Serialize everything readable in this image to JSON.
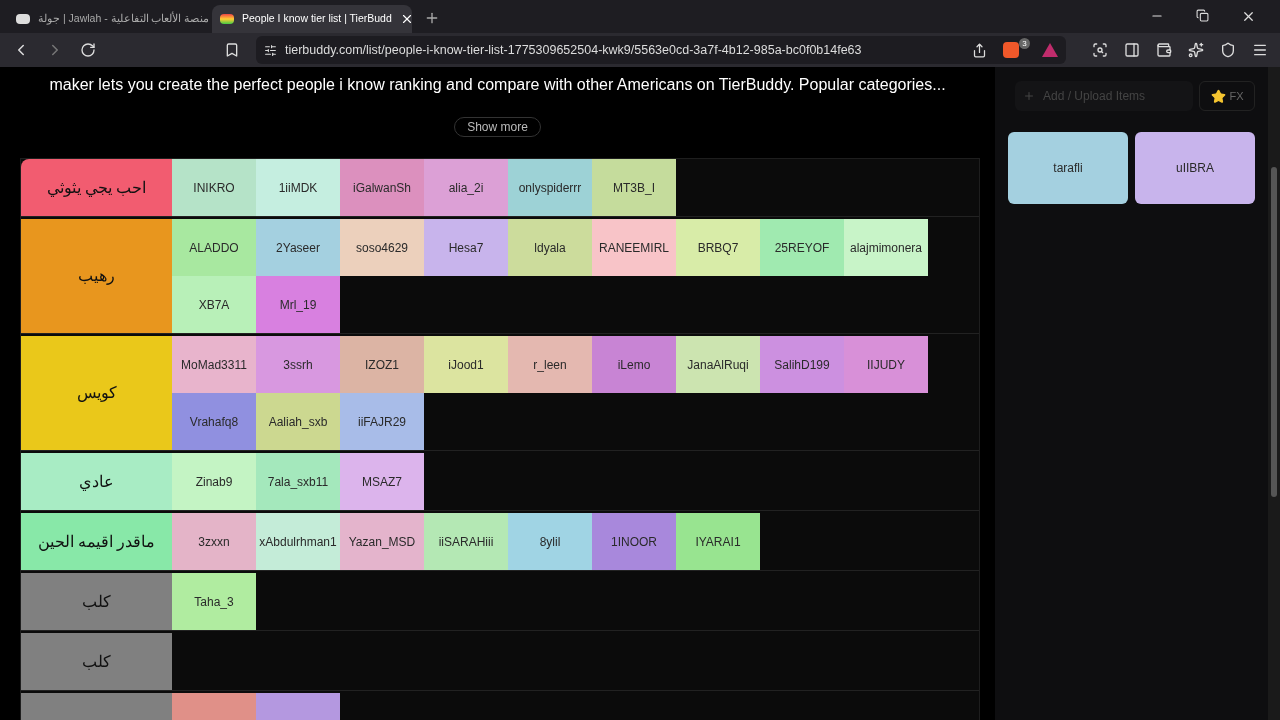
{
  "browser": {
    "tabs": [
      {
        "title": "جولة | Jawlah - منصة الألعاب التفاعلية",
        "selected": false
      },
      {
        "title": "People I know tier list | TierBudd",
        "selected": true
      }
    ],
    "url": "tierbuddy.com/list/people-i-know-tier-list-1775309652504-kwk9/5563e0cd-3a7f-4b12-985a-bc0f0b14fe63",
    "shield_count": "3"
  },
  "description": "maker lets you create the perfect people i know ranking and compare with other Americans on TierBuddy. Popular categories...",
  "show_more": "Show more",
  "tiers": [
    {
      "label": "احب يجي يثوثي",
      "color": "#f25c70",
      "items": [
        {
          "name": "INIKRO",
          "color": "#b5e3c8"
        },
        {
          "name": "1iiMDK",
          "color": "#c5eee0"
        },
        {
          "name": "iGalwanSh",
          "color": "#dc90be"
        },
        {
          "name": "alia_2i",
          "color": "#dca0d6"
        },
        {
          "name": "onlyspiderrr",
          "color": "#9dd2d6"
        },
        {
          "name": "MT3B_I",
          "color": "#c5dc9c"
        }
      ]
    },
    {
      "label": "رهيب",
      "color": "#e8961e",
      "items": [
        {
          "name": "ALADDO",
          "color": "#a8e8a0"
        },
        {
          "name": "2Yaseer",
          "color": "#a4d0e0"
        },
        {
          "name": "soso4629",
          "color": "#ecd0bc"
        },
        {
          "name": "Hesa7",
          "color": "#c8b4ec"
        },
        {
          "name": "ldyala",
          "color": "#ccdc9c"
        },
        {
          "name": "RANEEMIRL",
          "color": "#f8c4c8"
        },
        {
          "name": "BRBQ7",
          "color": "#d8eca8"
        },
        {
          "name": "25REYOF",
          "color": "#a0eab0"
        },
        {
          "name": "alajmimonera",
          "color": "#c8f4c8"
        },
        {
          "name": "XB7A",
          "color": "#b8f0b8"
        },
        {
          "name": "Mrl_19",
          "color": "#d880e0"
        }
      ]
    },
    {
      "label": "كويس",
      "color": "#eac81a",
      "items": [
        {
          "name": "MoMad3311",
          "color": "#e8b4cc"
        },
        {
          "name": "3ssrh",
          "color": "#d898e0"
        },
        {
          "name": "IZOZ1",
          "color": "#dcb4a4"
        },
        {
          "name": "iJood1",
          "color": "#dce4a0"
        },
        {
          "name": "r_leen",
          "color": "#e4b8b0"
        },
        {
          "name": "iLemo",
          "color": "#c884d4"
        },
        {
          "name": "JanaAlRuqi",
          "color": "#cce4b0"
        },
        {
          "name": "SalihD199",
          "color": "#cc90e0"
        },
        {
          "name": "IIJUDY",
          "color": "#d890d8"
        },
        {
          "name": "Vrahafq8",
          "color": "#9090e0"
        },
        {
          "name": "Aaliah_sxb",
          "color": "#ccd890"
        },
        {
          "name": "iiFAJR29",
          "color": "#a8bce8"
        }
      ]
    },
    {
      "label": "عادي",
      "color": "#a8ecc4",
      "items": [
        {
          "name": "Zinab9",
          "color": "#c4f4c4"
        },
        {
          "name": "7ala_sxb11",
          "color": "#a4e8bc"
        },
        {
          "name": "MSAZ7",
          "color": "#dcb4ec"
        }
      ]
    },
    {
      "label": "ماقدر اقيمه الحين",
      "color": "#88e8a8",
      "items": [
        {
          "name": "3zxxn",
          "color": "#e4b4c8"
        },
        {
          "name": "xAbdulrhman1",
          "color": "#c4ecd8"
        },
        {
          "name": "Yazan_MSD",
          "color": "#e4b4cc"
        },
        {
          "name": "iiSARAHiii",
          "color": "#b4e8b4"
        },
        {
          "name": "8ylil",
          "color": "#a0d4e4"
        },
        {
          "name": "1INOOR",
          "color": "#a888dc"
        },
        {
          "name": "IYARAI1",
          "color": "#98e490"
        }
      ]
    },
    {
      "label": "كلب",
      "color": "#808080",
      "items": [
        {
          "name": "Taha_3",
          "color": "#b0ecA0"
        }
      ]
    },
    {
      "label": "كلب",
      "color": "#808080"
    },
    {
      "color": "#808080",
      "items": [
        {
          "color": "#e09088"
        },
        {
          "color": "#b498e0"
        }
      ]
    }
  ],
  "sidebar": {
    "add_placeholder": "Add / Upload Items",
    "fx": "FX",
    "items": [
      {
        "name": "tarafli",
        "color": "#a4d0e0"
      },
      {
        "name": "uIIBRA",
        "color": "#c8b4ec"
      }
    ]
  }
}
